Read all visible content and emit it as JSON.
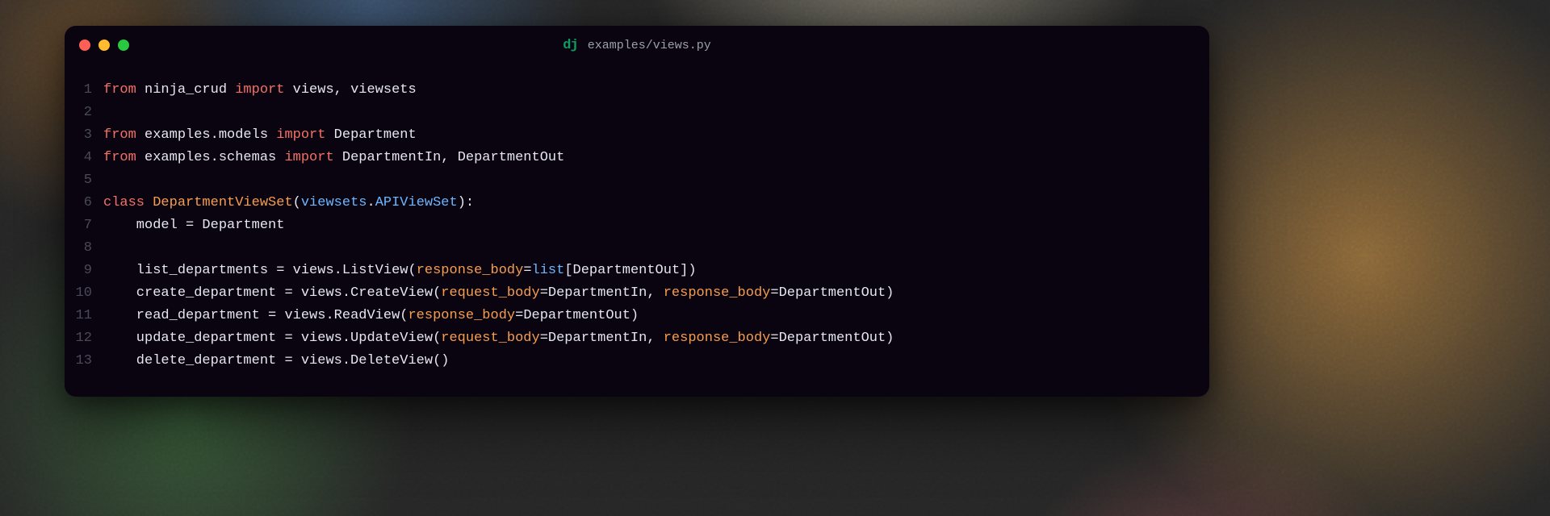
{
  "title": {
    "icon_text": "dj",
    "path": "examples/views.py"
  },
  "code": {
    "lines": [
      {
        "n": 1,
        "tokens": [
          {
            "t": "from ",
            "c": "c-key"
          },
          {
            "t": "ninja_crud ",
            "c": "c-id"
          },
          {
            "t": "import ",
            "c": "c-imp"
          },
          {
            "t": "views, viewsets",
            "c": "c-id"
          }
        ]
      },
      {
        "n": 2,
        "tokens": []
      },
      {
        "n": 3,
        "tokens": [
          {
            "t": "from ",
            "c": "c-key"
          },
          {
            "t": "examples.models ",
            "c": "c-id"
          },
          {
            "t": "import ",
            "c": "c-imp"
          },
          {
            "t": "Department",
            "c": "c-id"
          }
        ]
      },
      {
        "n": 4,
        "tokens": [
          {
            "t": "from ",
            "c": "c-key"
          },
          {
            "t": "examples.schemas ",
            "c": "c-id"
          },
          {
            "t": "import ",
            "c": "c-imp"
          },
          {
            "t": "DepartmentIn, DepartmentOut",
            "c": "c-id"
          }
        ]
      },
      {
        "n": 5,
        "tokens": []
      },
      {
        "n": 6,
        "tokens": [
          {
            "t": "class ",
            "c": "c-key"
          },
          {
            "t": "DepartmentViewSet",
            "c": "c-cls"
          },
          {
            "t": "(",
            "c": "c-punc"
          },
          {
            "t": "viewsets",
            "c": "c-call"
          },
          {
            "t": ".",
            "c": "c-dot"
          },
          {
            "t": "APIViewSet",
            "c": "c-call2"
          },
          {
            "t": "):",
            "c": "c-punc"
          }
        ]
      },
      {
        "n": 7,
        "tokens": [
          {
            "t": "    model ",
            "c": "c-id"
          },
          {
            "t": "=",
            "c": "c-op"
          },
          {
            "t": " Department",
            "c": "c-id"
          }
        ]
      },
      {
        "n": 8,
        "tokens": []
      },
      {
        "n": 9,
        "tokens": [
          {
            "t": "    list_departments ",
            "c": "c-id"
          },
          {
            "t": "=",
            "c": "c-op"
          },
          {
            "t": " views.ListView(",
            "c": "c-id"
          },
          {
            "t": "response_body",
            "c": "c-param"
          },
          {
            "t": "=",
            "c": "c-op"
          },
          {
            "t": "list",
            "c": "c-call"
          },
          {
            "t": "[DepartmentOut])",
            "c": "c-id"
          }
        ]
      },
      {
        "n": 10,
        "tokens": [
          {
            "t": "    create_department ",
            "c": "c-id"
          },
          {
            "t": "=",
            "c": "c-op"
          },
          {
            "t": " views.CreateView(",
            "c": "c-id"
          },
          {
            "t": "request_body",
            "c": "c-param"
          },
          {
            "t": "=",
            "c": "c-op"
          },
          {
            "t": "DepartmentIn, ",
            "c": "c-id"
          },
          {
            "t": "response_body",
            "c": "c-param"
          },
          {
            "t": "=",
            "c": "c-op"
          },
          {
            "t": "DepartmentOut)",
            "c": "c-id"
          }
        ]
      },
      {
        "n": 11,
        "tokens": [
          {
            "t": "    read_department ",
            "c": "c-id"
          },
          {
            "t": "=",
            "c": "c-op"
          },
          {
            "t": " views.ReadView(",
            "c": "c-id"
          },
          {
            "t": "response_body",
            "c": "c-param"
          },
          {
            "t": "=",
            "c": "c-op"
          },
          {
            "t": "DepartmentOut)",
            "c": "c-id"
          }
        ]
      },
      {
        "n": 12,
        "tokens": [
          {
            "t": "    update_department ",
            "c": "c-id"
          },
          {
            "t": "=",
            "c": "c-op"
          },
          {
            "t": " views.UpdateView(",
            "c": "c-id"
          },
          {
            "t": "request_body",
            "c": "c-param"
          },
          {
            "t": "=",
            "c": "c-op"
          },
          {
            "t": "DepartmentIn, ",
            "c": "c-id"
          },
          {
            "t": "response_body",
            "c": "c-param"
          },
          {
            "t": "=",
            "c": "c-op"
          },
          {
            "t": "DepartmentOut)",
            "c": "c-id"
          }
        ]
      },
      {
        "n": 13,
        "tokens": [
          {
            "t": "    delete_department ",
            "c": "c-id"
          },
          {
            "t": "=",
            "c": "c-op"
          },
          {
            "t": " views.DeleteView()",
            "c": "c-id"
          }
        ]
      }
    ]
  }
}
